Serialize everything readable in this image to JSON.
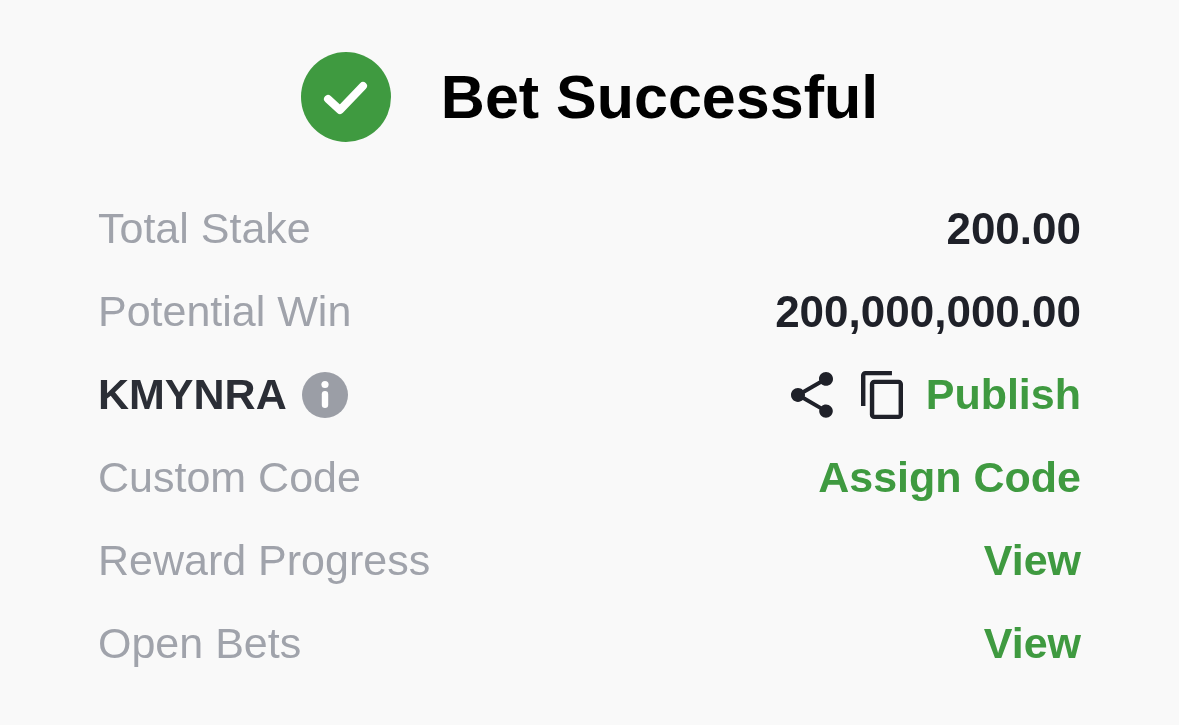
{
  "header": {
    "title": "Bet Successful"
  },
  "rows": [
    {
      "kind": "value",
      "label": "Total Stake",
      "value": "200.00"
    },
    {
      "kind": "value",
      "label": "Potential Win",
      "value": "200,000,000.00"
    },
    {
      "kind": "code",
      "code": "KMYNRA",
      "action": "Publish"
    },
    {
      "kind": "link",
      "label": "Custom Code",
      "action": "Assign Code"
    },
    {
      "kind": "link",
      "label": "Reward Progress",
      "action": "View"
    },
    {
      "kind": "link",
      "label": "Open Bets",
      "action": "View"
    }
  ]
}
